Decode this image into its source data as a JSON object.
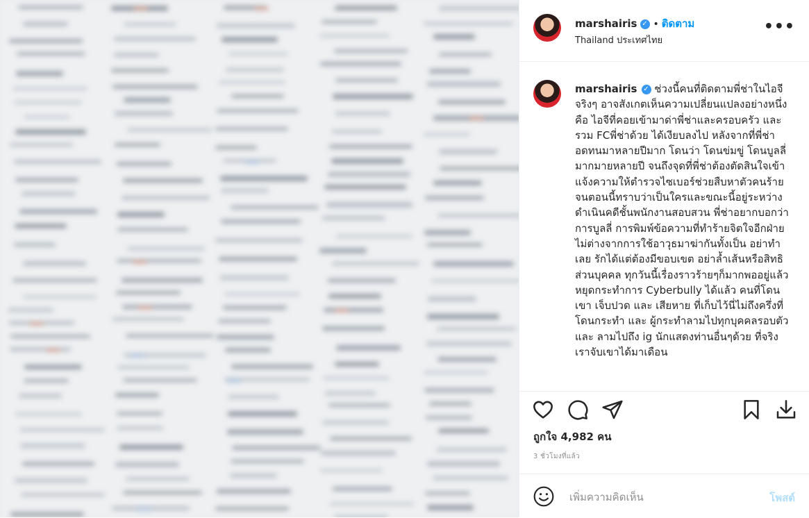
{
  "post": {
    "username": "marshairis",
    "verified_icon": "verified-badge-icon",
    "separator": "•",
    "follow_label": "ติดตาม",
    "location": "Thailand ประเทศไทย",
    "more_icon": "more-options-icon",
    "more_label": "•••"
  },
  "caption": {
    "username": "marshairis",
    "text": "ช่วงนี้คนที่ติดตามพี่ช่าในไอจีจริงๆ อาจสังเกตเห็นความเปลี่ยนแปลงอย่างหนึ่งคือ ไอจีที่คอยเข้ามาด่าพี่ช่าและครอบครัว และรวม FCพี่ช่าด้วย ได้เงียบลงไป หลังจากที่พี่ช่าอดทนมาหลายปีมาก โดนว่า โดนข่มขู่ โดนบูลลี่มากมายหลายปี จนถึงจุดที่พี่ช่าต้องตัดสินใจเข้าแจ้งความให้ตำรวจไซเบอร์ช่วยสืบหาตัวคนร้าย จนตอนนี้ทราบว่าเป็นใครและขณะนี้อยู่ระหว่างดำเนินคดีชั้นพนักงานสอบสวน พี่ช่าอยากบอกว่าการบูลลี่ การพิมพ์ข้อความที่ทำร้ายจิตใจอีกฝ่าย ไม่ต่างจากการใช้อาวุธมาฆ่ากันทั้งเป็น อย่าทำเลย รักได้แต่ต้องมีขอบเขต อย่าล้ำเส้นหรือสิทธิส่วนบุคคล ทุกวันนี้เรื่องราวร้ายๆก็มากพออยู่แล้ว หยุดกระทำการ Cyberbully ได้แล้ว คนที่โดนเขา เจ็บปวด และ เสียหาย ที่เก็บไว้นี่ไม่ถึงครึ่งที่โดนกระทำ และ ผู้กระทำลามไปทุกบุคคลรอบตัว และ ลามไปถึง ig นักแสดงท่านอื่นๆด้วย ที่จริงเราจับเขาได้มาเดือน"
  },
  "actions": {
    "like_icon": "heart-icon",
    "comment_icon": "comment-icon",
    "share_icon": "share-icon",
    "save_icon": "bookmark-icon",
    "download_icon": "download-icon"
  },
  "likes_text": "ถูกใจ 4,982 คน",
  "timestamp": "3 ชั่วโมงที่แล้ว",
  "comment_box": {
    "emoji_icon": "emoji-icon",
    "placeholder": "เพิ่มความคิดเห็น",
    "post_label": "โพสต์"
  },
  "colors": {
    "accent": "#0095f6",
    "post_disabled": "#b2dffc",
    "verified": "#3897f0",
    "text": "#262626",
    "muted": "#8e8e8e"
  }
}
